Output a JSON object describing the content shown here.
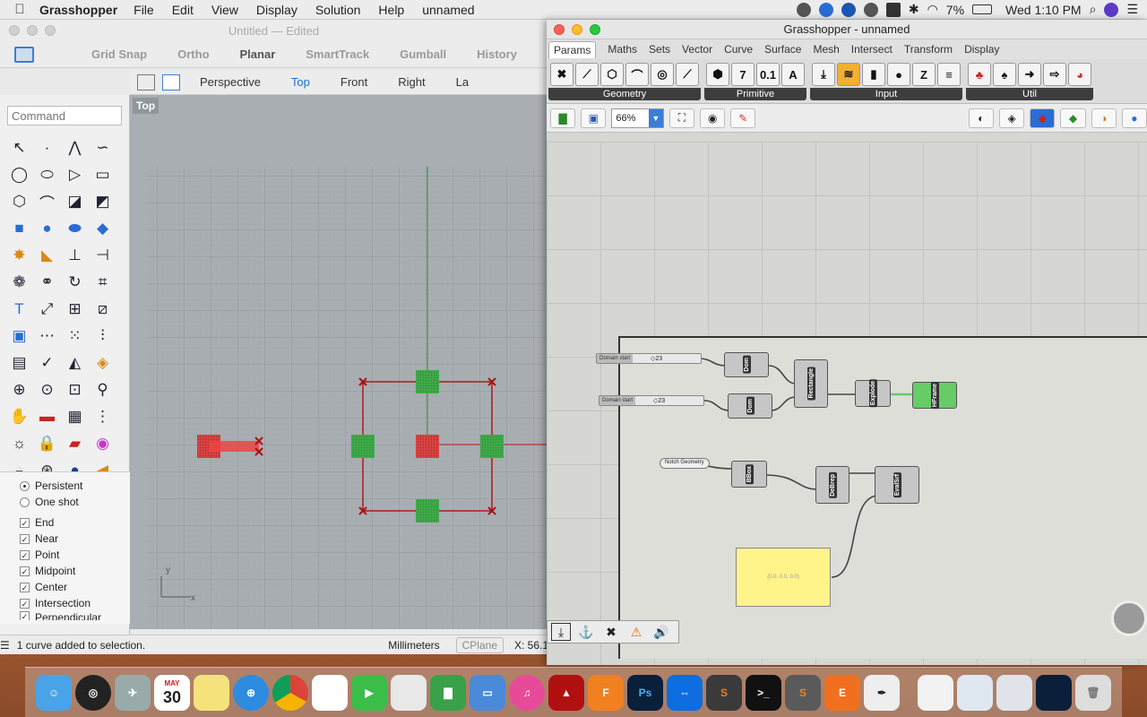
{
  "menubar": {
    "app_name": "Grasshopper",
    "items": [
      "File",
      "Edit",
      "View",
      "Display",
      "Solution",
      "Help",
      "unnamed"
    ],
    "battery": "7%",
    "clock": "Wed 1:10 PM"
  },
  "rhino": {
    "title": "Untitled — Edited",
    "snap_items": [
      "Grid Snap",
      "Ortho",
      "Planar",
      "SmartTrack",
      "Gumball",
      "History"
    ],
    "view_tabs": [
      "Perspective",
      "Top",
      "Front",
      "Right",
      "La"
    ],
    "active_tab": "Top",
    "command_placeholder": "Command",
    "viewport_label": "Top",
    "osnap": {
      "radios": [
        {
          "label": "Persistent",
          "on": true
        },
        {
          "label": "One shot",
          "on": false
        }
      ],
      "checks": [
        "End",
        "Near",
        "Point",
        "Midpoint",
        "Center",
        "Intersection",
        "Perpendicular"
      ]
    },
    "status": {
      "message": "1 curve added to selection.",
      "units": "Millimeters",
      "cplane": "CPlane",
      "coord": "X: 56.1"
    },
    "axis_x": "x",
    "axis_y": "y"
  },
  "grasshopper": {
    "title": "Grasshopper - unnamed",
    "tabs": [
      "Params",
      "Maths",
      "Sets",
      "Vector",
      "Curve",
      "Surface",
      "Mesh",
      "Intersect",
      "Transform",
      "Display"
    ],
    "active_tab": "Params",
    "ribbon_groups": [
      "Geometry",
      "Primitive",
      "Input",
      "Util"
    ],
    "zoom": "66%",
    "components": {
      "domain_start_1": "Domain start",
      "domain_start_2": "Domain start",
      "slider_value_1": "◇23",
      "slider_value_2": "◇23",
      "dom1": "Dom",
      "dom2": "Dom",
      "rectangle": "Rectangle",
      "explode": "Explode",
      "hframe": "HFrame",
      "notch": "Notch Geometry",
      "bbox": "BBox",
      "debrep": "DeBrep",
      "evalsrf": "EvalSrf",
      "panel_text": "{0.0,  0.0,  0.0}"
    }
  },
  "dock": {
    "calendar_month": "MAY",
    "calendar_day": "30",
    "apps": [
      "Finder",
      "Siri",
      "Launchpad",
      "Calendar",
      "Notes",
      "Safari",
      "Chrome",
      "Photos",
      "FaceTime",
      "Preview",
      "Numbers",
      "Keynote",
      "iTunes",
      "Acrobat",
      "Fusion 360",
      "Photoshop",
      "TeamViewer",
      "Sublime",
      "Terminal",
      "Sublime Text",
      "Eagle",
      "Inkscape",
      "Files",
      "Downloads",
      "Trash"
    ]
  }
}
